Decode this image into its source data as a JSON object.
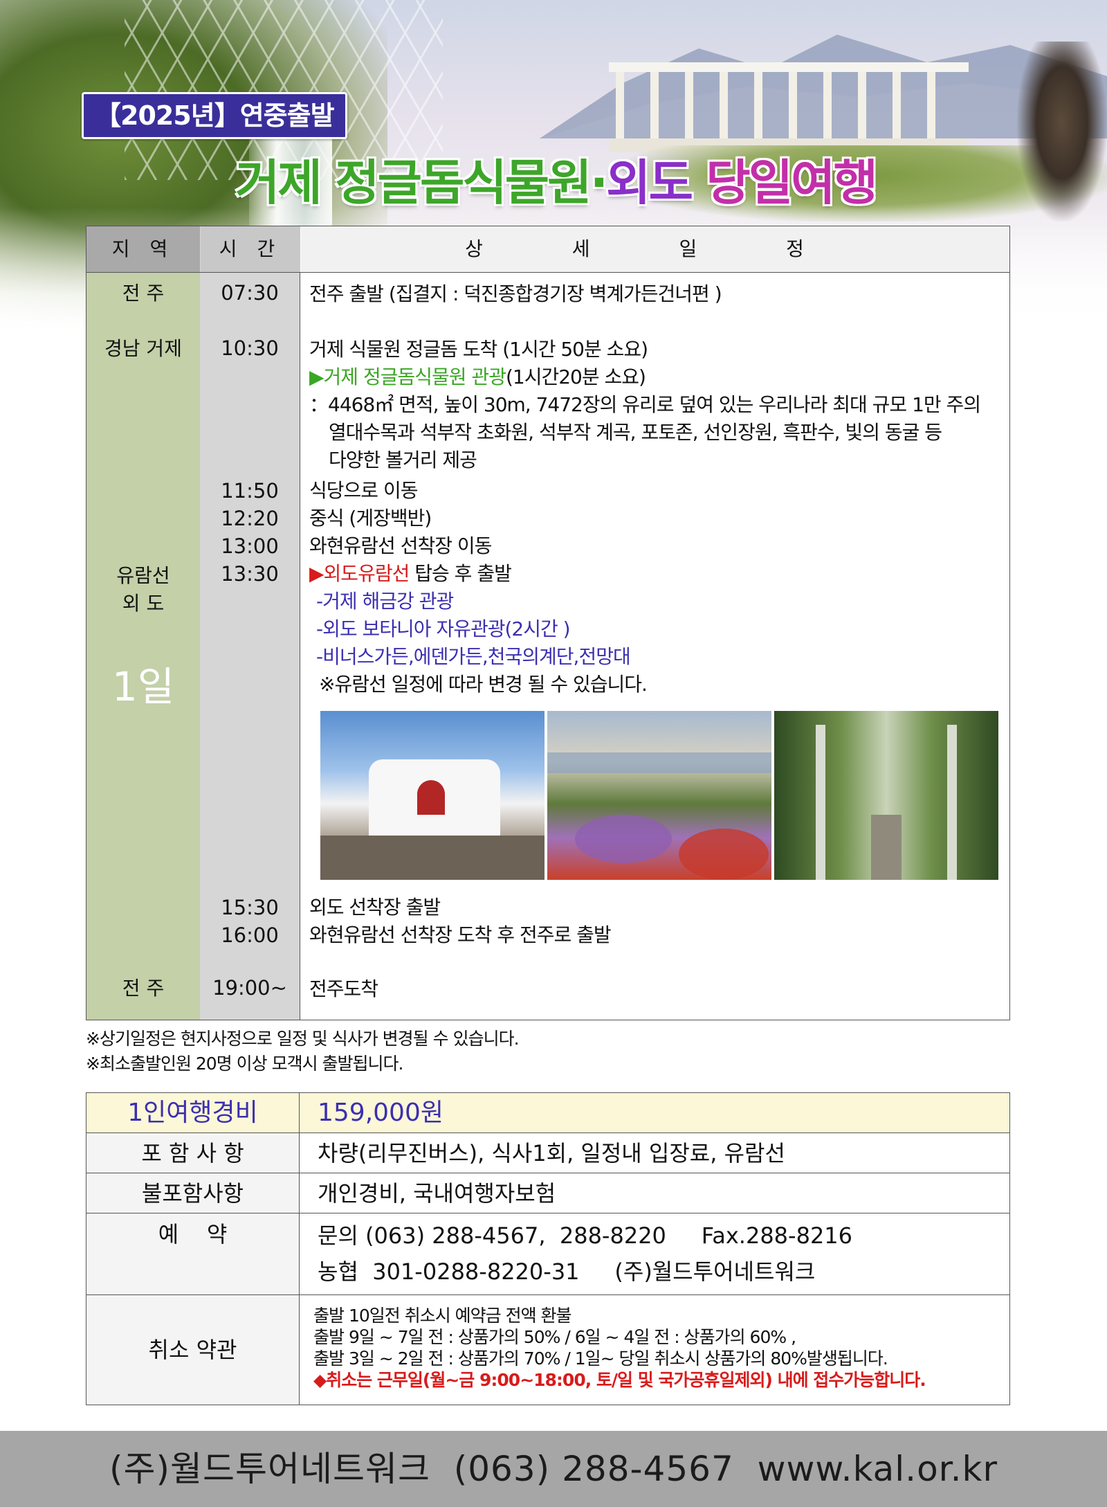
{
  "header": {
    "badge": "【2025년】연중출발",
    "title_part1": "거제 정글돔식물원",
    "title_dot": "·",
    "title_part2": "외도",
    "title_part3": "당일여행"
  },
  "itinerary": {
    "headers": {
      "region": "지 역",
      "time": "시 간",
      "detail": "상 세 일 정"
    },
    "regions": {
      "jeonju_start": "전 주",
      "geoje": "경남 거제",
      "cruise": "유람선",
      "oedo": "외 도",
      "day": "1일",
      "jeonju_end": "전 주"
    },
    "times": [
      "07:30",
      "10:30",
      "11:50",
      "12:20",
      "13:00",
      "13:30",
      "15:30",
      "16:00",
      "19:00~"
    ],
    "lines": {
      "depart": "전주 출발 (집결지 : 덕진종합경기장 벽계가든건너편 )",
      "arrive_dome": "거제 식물원 정글돔 도착 (1시간 50분 소요)",
      "tour_dome_marker": "▶",
      "tour_dome_name": "거제 정글돔식물원 관광",
      "tour_dome_time": "(1시간20분 소요)",
      "dome_desc1": "：4468㎡ 면적, 높이 30m, 7472장의 유리로 덮여 있는 우리나라 최대 규모 1만 주의",
      "dome_desc2": "열대수목과 석부작 초화원, 석부작 계곡, 포토존, 선인장원, 흑판수, 빛의 동굴 등",
      "dome_desc3": "다양한 볼거리 제공",
      "restaurant": "식당으로 이동",
      "lunch": "중식 (게장백반)",
      "move_pier": "와현유람선 선착장 이동",
      "cruise_marker": "▶",
      "cruise_name": "외도유람선",
      "cruise_rest": " 탑승 후 출발",
      "sub1": "-거제 해금강 관광",
      "sub2": "-외도 보타니아 자유관광(2시간 )",
      "sub3": "-비너스가든,에덴가든,천국의계단,전망대",
      "sub_note": "※유람선 일정에 따라 변경 될 수 있습니다.",
      "oedo_depart": "외도 선착장 출발",
      "return": "와현유람선 선착장 도착 후 전주로 출발",
      "arrive_jeonju": "전주도착"
    }
  },
  "notes": [
    "※상기일정은 현지사정으로 일정 및 식사가 변경될 수 있습니다.",
    "※최소출발인원 20명 이상 모객시 출발됩니다."
  ],
  "price_table": {
    "cost_label": "1인여행경비",
    "cost_value": "159,000원",
    "include_label": "포 함 사 항",
    "include_value": "차량(리무진버스), 식사1회, 일정내 입장료, 유람선",
    "exclude_label": "불포함사항",
    "exclude_value": "개인경비, 국내여행자보험",
    "reserve_label": "예    약",
    "reserve_line1": "문의 (063) 288-4567,  288-8220     Fax.288-8216",
    "reserve_line2": "농협  301-0288-8220-31     (주)월드투어네트워크",
    "cancel_label": "취소 약관",
    "cancel_lines": [
      "출발 10일전 취소시 예약금 전액 환불",
      "출발 9일 ~ 7일 전 : 상품가의 50% / 6일 ~ 4일 전 : 상품가의 60% ,",
      "출발 3일 ~ 2일 전 : 상품가의 70% / 1일~ 당일 취소시 상품가의 80%발생됩니다.",
      "◆취소는 근무일(월~금 9:00~18:00, 토/일 및 국가공휴일제외) 내에 접수가능합니다."
    ]
  },
  "footer": {
    "text": "(주)월드투어네트워크  (063) 288-4567  www.kal.or.kr"
  },
  "colors": {
    "badge_bg": "#3a2f9a",
    "title_green": "#3da629",
    "title_purple": "#8a2fc8",
    "accent_red": "#d81b1b",
    "accent_blue": "#3b2fb0",
    "region_col": "#c3d0a8",
    "time_col": "#d6d6d6",
    "cost_row": "#fbf7d7",
    "footer_bg": "#a6a6a6"
  }
}
